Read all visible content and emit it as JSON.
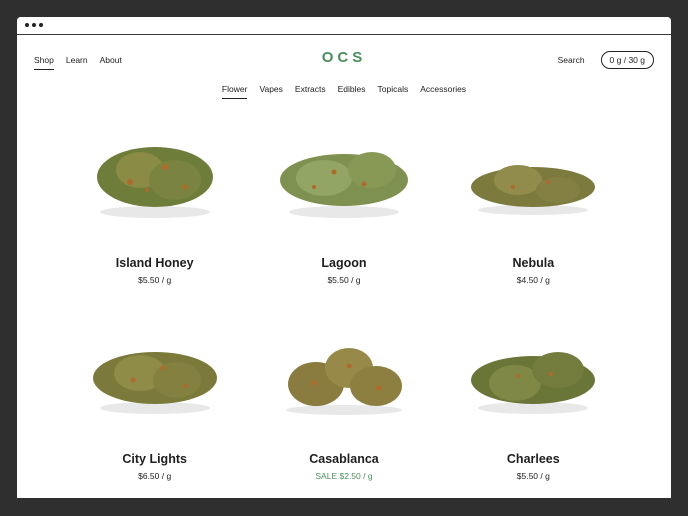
{
  "nav": {
    "left": [
      "Shop",
      "Learn",
      "About"
    ],
    "logo": "OCS",
    "search": "Search",
    "cart": "0 g / 30 g"
  },
  "categories": [
    "Flower",
    "Vapes",
    "Extracts",
    "Edibles",
    "Topicals",
    "Accessories"
  ],
  "products": [
    {
      "name": "Island Honey",
      "price": "$5.50 / g",
      "sale": false
    },
    {
      "name": "Lagoon",
      "price": "$5.50 / g",
      "sale": false
    },
    {
      "name": "Nebula",
      "price": "$4.50 / g",
      "sale": false
    },
    {
      "name": "City Lights",
      "price": "$6.50 / g",
      "sale": false
    },
    {
      "name": "Casablanca",
      "price": "SALE $2.50 / g",
      "sale": true
    },
    {
      "name": "Charlees",
      "price": "$5.50 / g",
      "sale": false
    }
  ],
  "colors": {
    "accent": "#4a8f5b",
    "bud_green": "#6f7d3a",
    "bud_orange": "#b06a2a"
  }
}
